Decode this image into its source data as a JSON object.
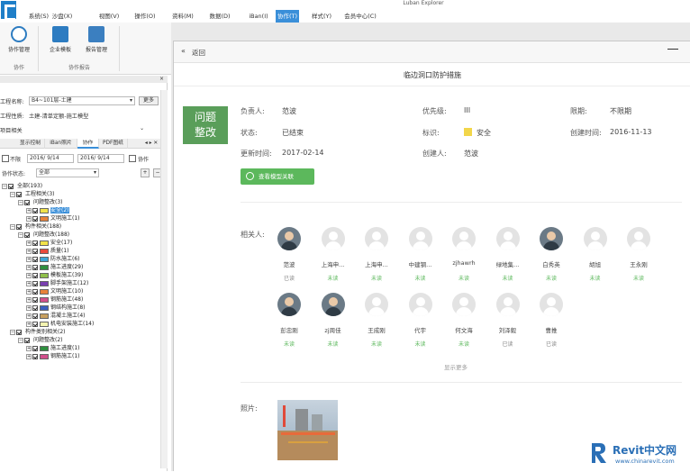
{
  "app": {
    "title": "Luban Explorer"
  },
  "menu": [
    "系统(S)",
    "沙盘(X)",
    "视图(V)",
    "操作(O)",
    "资料(M)",
    "数据(D)",
    "iBan(I)",
    "协作(T)",
    "样式(Y)",
    "会员中心(C)"
  ],
  "menu_active": 7,
  "ribbon": {
    "buttons": [
      "协作管理",
      "企业模板",
      "报告管理"
    ],
    "groups": [
      "协作",
      "协作报告"
    ]
  },
  "left": {
    "project_label": "工程名称:",
    "project_value": "B4~101层-土建",
    "more_button": "更多",
    "attr_label": "工程性质:",
    "attr_value": "土建-清单定额-施工模型",
    "section_title": "项目相关",
    "tabs": [
      "显示控制",
      "iBan照片",
      "协作",
      "PDF图纸"
    ],
    "tab_active": 2,
    "unlimited_label": "不限",
    "date_from": "2016/ 9/14",
    "date_to": "2016/ 9/14",
    "collab_label": "协作",
    "status_label": "协作状态:",
    "status_value": "全部",
    "tree": [
      {
        "label": "全部(193)",
        "level": 0,
        "color": ""
      },
      {
        "label": "工程相关(3)",
        "level": 1,
        "color": ""
      },
      {
        "label": "问题整改(3)",
        "level": 2,
        "color": ""
      },
      {
        "label": "安全(2)",
        "level": 3,
        "color": "#f2e24a",
        "highlight": true
      },
      {
        "label": "文明施工(1)",
        "level": 3,
        "color": "#e8823a"
      },
      {
        "label": "构件相关(188)",
        "level": 1,
        "color": ""
      },
      {
        "label": "问题整改(188)",
        "level": 2,
        "color": ""
      },
      {
        "label": "安全(17)",
        "level": 3,
        "color": "#f2e24a"
      },
      {
        "label": "质量(1)",
        "level": 3,
        "color": "#e94b3c"
      },
      {
        "label": "防水施工(6)",
        "level": 3,
        "color": "#3fa7d6"
      },
      {
        "label": "施工进度(29)",
        "level": 3,
        "color": "#2f8f3f"
      },
      {
        "label": "模板施工(39)",
        "level": 3,
        "color": "#8fbf4a"
      },
      {
        "label": "脚手架施工(12)",
        "level": 3,
        "color": "#7a3fb0"
      },
      {
        "label": "文明施工(10)",
        "level": 3,
        "color": "#e8823a"
      },
      {
        "label": "钢筋施工(48)",
        "level": 3,
        "color": "#d24f8c"
      },
      {
        "label": "钢结构施工(8)",
        "level": 3,
        "color": "#3b5fc0"
      },
      {
        "label": "混凝土施工(4)",
        "level": 3,
        "color": "#c8a060"
      },
      {
        "label": "机电安装施工(14)",
        "level": 3,
        "color": "#f4f4b0"
      },
      {
        "label": "构件类别相关(2)",
        "level": 1,
        "color": ""
      },
      {
        "label": "问题整改(2)",
        "level": 2,
        "color": ""
      },
      {
        "label": "施工进度(1)",
        "level": 3,
        "color": "#2f8f3f"
      },
      {
        "label": "钢筋施工(1)",
        "level": 3,
        "color": "#d24f8c"
      }
    ]
  },
  "dialog": {
    "back_label": "返回",
    "title": "临边洞口防护措施",
    "badge": "问题\n整改",
    "badge_line1": "问题",
    "badge_line2": "整改",
    "fields": {
      "owner_label": "负责人:",
      "owner": "范波",
      "priority_label": "优先级:",
      "priority": "III",
      "deadline_label": "限期:",
      "deadline": "不限期",
      "status_label": "状态:",
      "status": "已结束",
      "tag_label": "标识:",
      "tag": "安全",
      "tag_color": "#f2d64a",
      "created_label": "创建时间:",
      "created": "2016-11-13",
      "updated_label": "更新时间:",
      "updated": "2017-02-14",
      "creator_label": "创建人:",
      "creator": "范波"
    },
    "model_button": "查看模型关联",
    "related_label": "相关人:",
    "people": [
      {
        "name": "范波",
        "status": "已读",
        "photo": true
      },
      {
        "name": "上海申...",
        "status": "未读",
        "photo": false
      },
      {
        "name": "上海申...",
        "status": "未读",
        "photo": false
      },
      {
        "name": "中建钢...",
        "status": "未读",
        "photo": false
      },
      {
        "name": "zjhawrh",
        "status": "未读",
        "photo": false
      },
      {
        "name": "绿地集...",
        "status": "未读",
        "photo": false
      },
      {
        "name": "白秀英",
        "status": "未读",
        "photo": true
      },
      {
        "name": "胡旭",
        "status": "未读",
        "photo": false
      },
      {
        "name": "王永刚",
        "status": "未读",
        "photo": false
      },
      {
        "name": "彭忠刚",
        "status": "未读",
        "photo": true
      },
      {
        "name": "zj周佳",
        "status": "未读",
        "photo": true
      },
      {
        "name": "王成刚",
        "status": "未读",
        "photo": false
      },
      {
        "name": "代宇",
        "status": "未读",
        "photo": false
      },
      {
        "name": "何文海",
        "status": "未读",
        "photo": false
      },
      {
        "name": "刘泽毅",
        "status": "已读",
        "photo": false
      },
      {
        "name": "曹推",
        "status": "已读",
        "photo": false
      }
    ],
    "show_more": "显示更多",
    "photo_label": "照片:"
  },
  "watermark": {
    "brand": "Revit中文网",
    "url": "www.chinarevit.com"
  },
  "colors": {
    "accent": "#3a8fd9",
    "green": "#5cb85c",
    "badge": "#5a9e5a",
    "read": "#888888",
    "unread": "#5cb85c"
  }
}
